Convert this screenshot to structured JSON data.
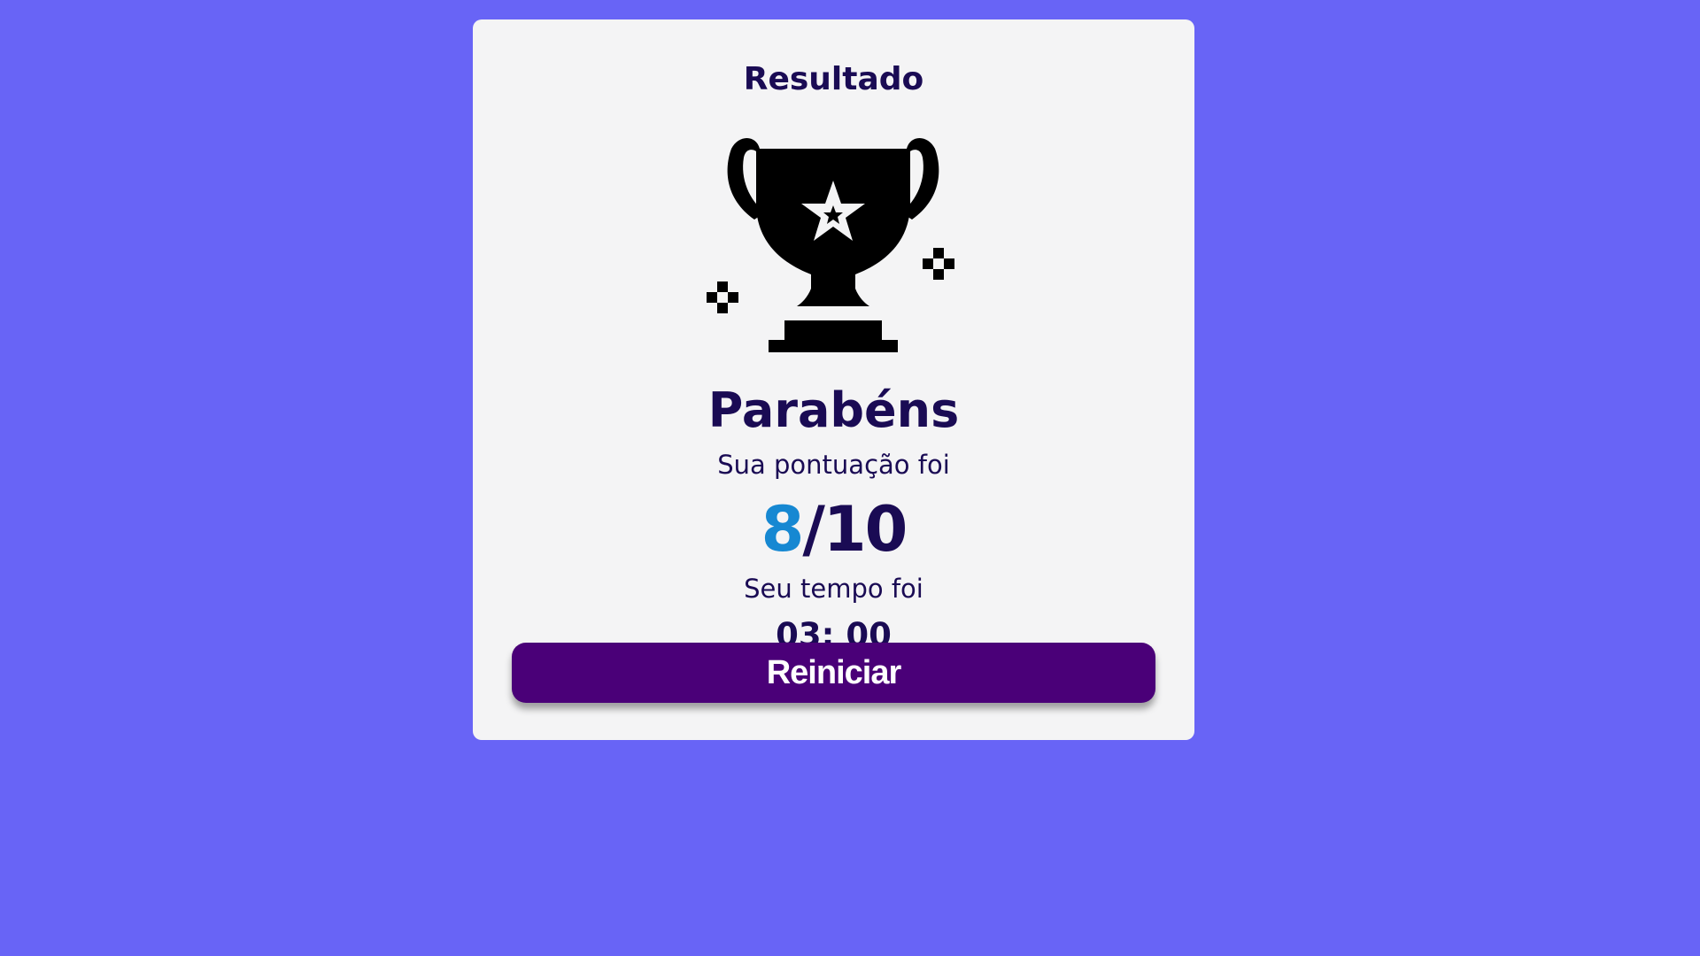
{
  "result_card": {
    "title": "Resultado",
    "trophy_icon": "trophy-star-icon",
    "headline": "Parabéns",
    "score_label": "Sua pontuação foi",
    "score_value": "8",
    "score_separator": "/10",
    "time_label": "Seu tempo foi",
    "time_value": "03: 00",
    "restart_label": "Reiniciar"
  },
  "colors": {
    "background": "#6864f6",
    "card": "#f4f4f5",
    "text": "#1a0b54",
    "score_accent": "#1688d2",
    "button": "#4a0078"
  }
}
